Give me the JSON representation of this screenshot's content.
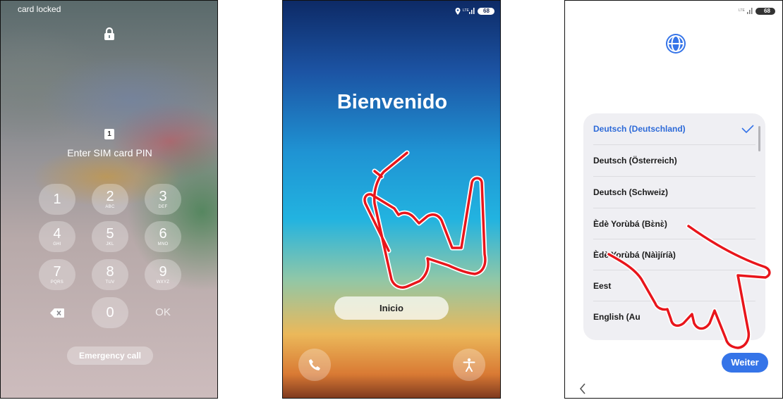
{
  "sim_screen": {
    "status_text": "card locked",
    "sim_slot": "1",
    "title": "Enter SIM card PIN",
    "keypad": [
      {
        "digit": "1",
        "letters": ""
      },
      {
        "digit": "2",
        "letters": "ABC"
      },
      {
        "digit": "3",
        "letters": "DEF"
      },
      {
        "digit": "4",
        "letters": "GHI"
      },
      {
        "digit": "5",
        "letters": "JKL"
      },
      {
        "digit": "6",
        "letters": "MNO"
      },
      {
        "digit": "7",
        "letters": "PQRS"
      },
      {
        "digit": "8",
        "letters": "TUV"
      },
      {
        "digit": "9",
        "letters": "WXYZ"
      }
    ],
    "zero": "0",
    "ok": "OK",
    "emergency": "Emergency call"
  },
  "welcome_screen": {
    "title": "Bienvenido",
    "start_button": "Inicio",
    "battery": "68"
  },
  "language_screen": {
    "battery": "68",
    "languages": [
      {
        "label": "Deutsch (Deutschland)",
        "selected": true
      },
      {
        "label": "Deutsch (Österreich)"
      },
      {
        "label": "Deutsch (Schweiz)"
      },
      {
        "label": "Èdè Yorùbá (Bɛ̀nɛ̀)"
      },
      {
        "label": "Èdè Yorùbá (Nàìjíríà)"
      },
      {
        "label": "Eest"
      },
      {
        "label": "English (Au"
      }
    ],
    "next_button": "Weiter"
  },
  "colors": {
    "accent": "#3574e8",
    "gesture": "#e8151b"
  },
  "icons": [
    "lock-icon",
    "sim-card-icon",
    "backspace-icon",
    "location-icon",
    "signal-icon",
    "battery-icon",
    "phone-icon",
    "accessibility-icon",
    "globe-icon",
    "check-icon",
    "back-icon",
    "pointing-hand-icon"
  ]
}
